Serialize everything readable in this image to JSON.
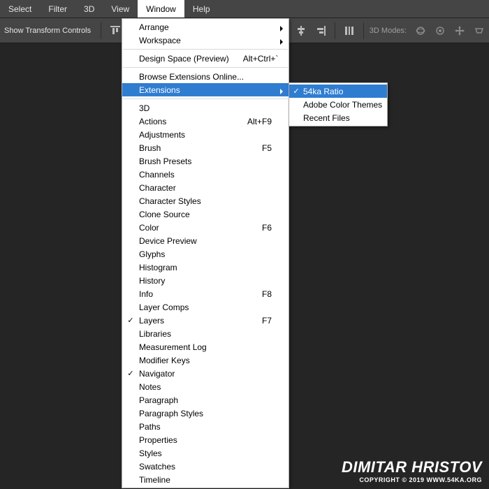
{
  "menubar": {
    "items": [
      {
        "label": "Select"
      },
      {
        "label": "Filter"
      },
      {
        "label": "3D"
      },
      {
        "label": "View"
      },
      {
        "label": "Window"
      },
      {
        "label": "Help"
      }
    ]
  },
  "optionsbar": {
    "transform_label": "Show Transform Controls",
    "modes_label": "3D Modes:"
  },
  "window_menu": {
    "top": [
      {
        "label": "Arrange",
        "submenu": true
      },
      {
        "label": "Workspace",
        "submenu": true
      }
    ],
    "design_space": {
      "label": "Design Space (Preview)",
      "shortcut": "Alt+Ctrl+`"
    },
    "mid": [
      {
        "label": "Browse Extensions Online..."
      },
      {
        "label": "Extensions",
        "submenu": true,
        "highlight": true
      }
    ],
    "panels": [
      {
        "label": "3D"
      },
      {
        "label": "Actions",
        "shortcut": "Alt+F9"
      },
      {
        "label": "Adjustments"
      },
      {
        "label": "Brush",
        "shortcut": "F5"
      },
      {
        "label": "Brush Presets"
      },
      {
        "label": "Channels"
      },
      {
        "label": "Character"
      },
      {
        "label": "Character Styles"
      },
      {
        "label": "Clone Source"
      },
      {
        "label": "Color",
        "shortcut": "F6"
      },
      {
        "label": "Device Preview"
      },
      {
        "label": "Glyphs"
      },
      {
        "label": "Histogram"
      },
      {
        "label": "History"
      },
      {
        "label": "Info",
        "shortcut": "F8"
      },
      {
        "label": "Layer Comps"
      },
      {
        "label": "Layers",
        "shortcut": "F7",
        "checked": true
      },
      {
        "label": "Libraries"
      },
      {
        "label": "Measurement Log"
      },
      {
        "label": "Modifier Keys"
      },
      {
        "label": "Navigator",
        "checked": true
      },
      {
        "label": "Notes"
      },
      {
        "label": "Paragraph"
      },
      {
        "label": "Paragraph Styles"
      },
      {
        "label": "Paths"
      },
      {
        "label": "Properties"
      },
      {
        "label": "Styles"
      },
      {
        "label": "Swatches"
      },
      {
        "label": "Timeline"
      }
    ]
  },
  "submenu": {
    "items": [
      {
        "label": "54ka Ratio",
        "checked": true,
        "highlight": true
      },
      {
        "label": "Adobe Color Themes"
      },
      {
        "label": "Recent Files"
      }
    ]
  },
  "watermark": {
    "name": "DIMITAR HRISTOV",
    "copy": "COPYRIGHT © 2019 WWW.54KA.ORG"
  }
}
